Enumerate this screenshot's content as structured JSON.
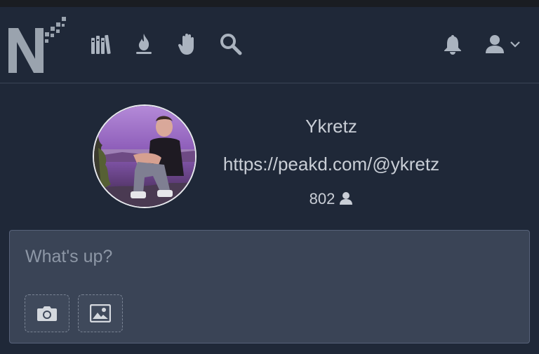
{
  "nav": {
    "logo": "N",
    "icons": [
      "library-icon",
      "fire-icon",
      "hand-icon",
      "search-icon"
    ],
    "right_icons": [
      "bell-icon",
      "user-icon",
      "chevron-down-icon"
    ]
  },
  "profile": {
    "username": "Ykretz",
    "website": "https://peakd.com/@ykretz",
    "followers": "802"
  },
  "composer": {
    "placeholder": "What's up?",
    "buttons": [
      "camera-icon",
      "image-icon"
    ]
  },
  "colors": {
    "background": "#1f2838",
    "composer_bg": "#3a4456",
    "icon": "#aab3bf"
  }
}
